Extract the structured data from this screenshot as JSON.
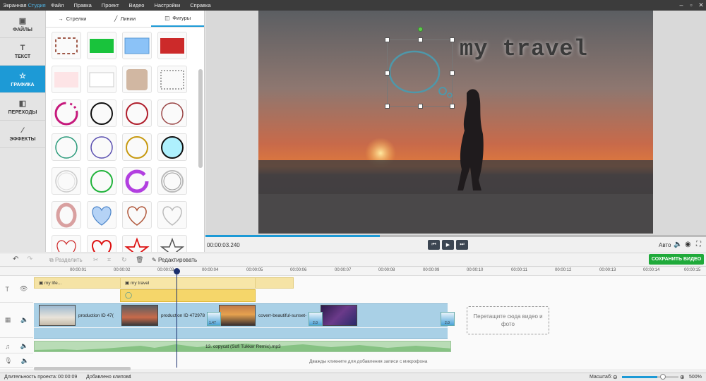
{
  "app": {
    "title_part1": "Экранная ",
    "title_part2": "Студия"
  },
  "menu": [
    "Файл",
    "Правка",
    "Проект",
    "Видео",
    "Настройки",
    "Справка"
  ],
  "leftnav": [
    {
      "label": "ФАЙЛЫ",
      "icon": "image-icon"
    },
    {
      "label": "ТЕКСТ",
      "icon": "text-t-icon"
    },
    {
      "label": "ГРАФИКА",
      "icon": "star-icon",
      "active": true
    },
    {
      "label": "ПЕРЕХОДЫ",
      "icon": "transitions-icon"
    },
    {
      "label": "ЭФФЕКТЫ",
      "icon": "magic-wand-icon"
    }
  ],
  "shape_tabs": [
    "Стрелки",
    "Линии",
    "Фигуры"
  ],
  "preview": {
    "overlay_title": "my travel",
    "timecode": "00:00:03.240",
    "auto_label": "Авто"
  },
  "toolbar": {
    "split": "Разделить",
    "edit": "Редактировать",
    "save": "СОХРАНИТЬ ВИДЕО"
  },
  "ruler": [
    "00:00:01",
    "00:00:02",
    "00:00:03",
    "00:00:04",
    "00:00:05",
    "00:00:06",
    "00:00:07",
    "00:00:08",
    "00:00:09",
    "00:00:10",
    "00:00:11",
    "00:00:12",
    "00:00:13",
    "00:00:14",
    "00:00:15"
  ],
  "timeline": {
    "text_clip_1": "my life...",
    "text_clip_2": "my travel",
    "video_clip_1": "production ID 47(",
    "video_clip_2": "production ID 472978",
    "video_clip_3": "coverr-beautiful-sunset-",
    "transition_1": "1.47",
    "transition_2": "2.0",
    "transition_3": "2.0",
    "drop_hint": "Перетащите сюда видео и фото",
    "audio_clip": "13. copycat (Sofi Tukker Remix).mp3",
    "mic_hint": "Дважды кликните для добавления записи с микрофона"
  },
  "status": {
    "duration_label": "Длительность проекта:",
    "duration_value": "00:00:09",
    "clips_label": "Добавлено клипов:",
    "clips_value": "4",
    "scale_label": "Масштаб:",
    "zoom": "500%"
  },
  "colors": {
    "accent": "#1d9ad6",
    "save_green": "#1faa3a"
  }
}
